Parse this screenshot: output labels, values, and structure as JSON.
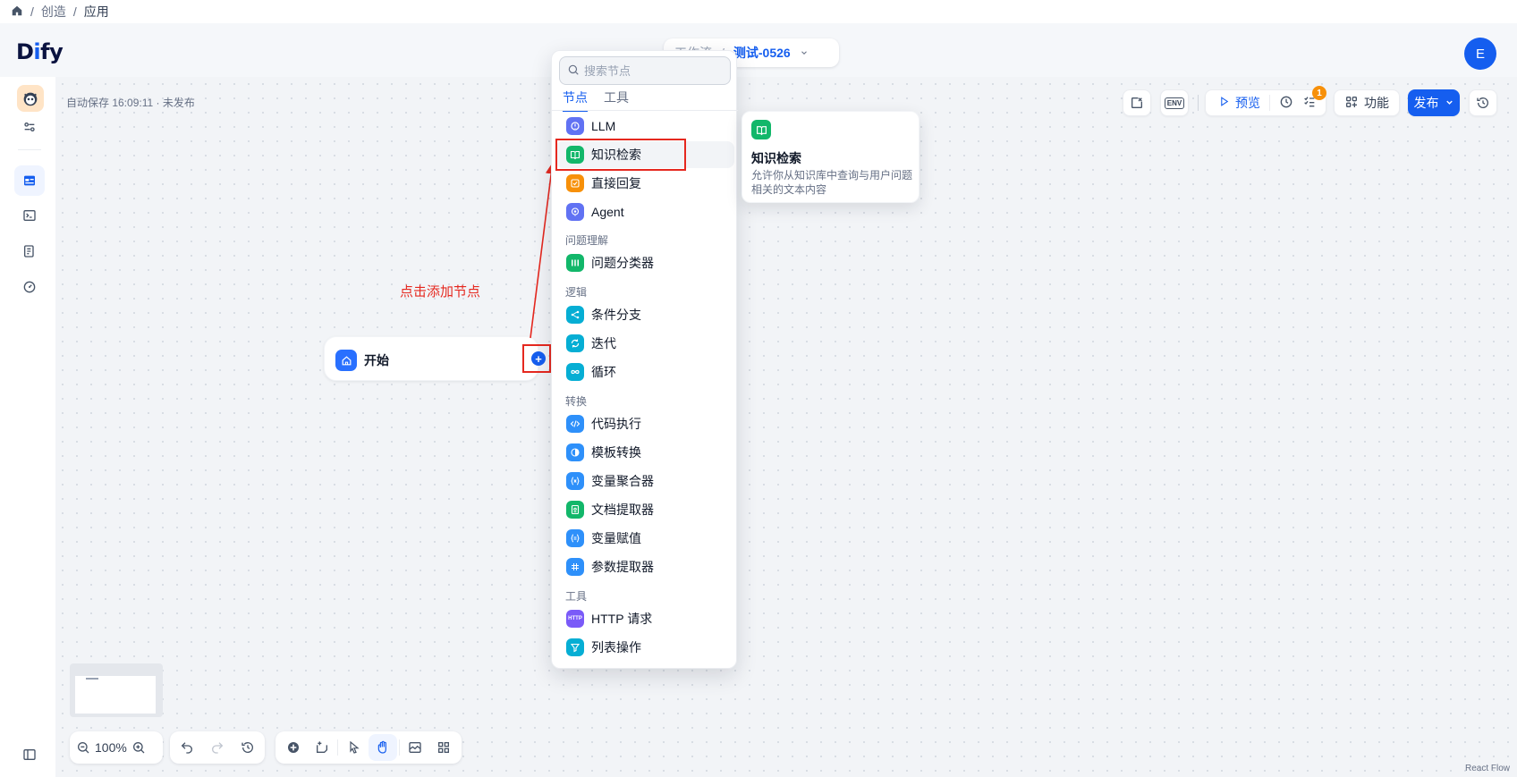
{
  "breadcrumb": {
    "home_icon": "home-icon",
    "sep": "/",
    "item1": "创造",
    "item2": "应用"
  },
  "header": {
    "logo_prefix": "D",
    "logo_i": "i",
    "logo_suffix": "fy",
    "tab_left": "工作流",
    "tab_right": "测试-0526",
    "avatar_letter": "E"
  },
  "canvas": {
    "autosave": "自动保存 16:09:11 · 未发布"
  },
  "toolbar": {
    "env_label": "ENV",
    "preview": "预览",
    "checklist_badge": "1",
    "features": "功能",
    "publish": "发布"
  },
  "start_node": {
    "label": "开始"
  },
  "annotation": {
    "text": "点击添加节点",
    "color": "#e5281f"
  },
  "node_menu": {
    "search_placeholder": "搜索节点",
    "tabs": [
      "节点",
      "工具"
    ],
    "items_top": [
      {
        "label": "LLM",
        "color": "#6172f3",
        "icon": "llm-icon"
      },
      {
        "label": "知识检索",
        "color": "#12b76a",
        "icon": "knowledge-retrieval-icon"
      },
      {
        "label": "直接回复",
        "color": "#f79009",
        "icon": "direct-reply-icon"
      },
      {
        "label": "Agent",
        "color": "#6172f3",
        "icon": "agent-icon"
      }
    ],
    "group_understanding": "问题理解",
    "items_understanding": [
      {
        "label": "问题分类器",
        "color": "#12b76a",
        "icon": "question-classifier-icon"
      }
    ],
    "group_logic": "逻辑",
    "items_logic": [
      {
        "label": "条件分支",
        "color": "#06aed4",
        "icon": "if-else-icon"
      },
      {
        "label": "迭代",
        "color": "#06aed4",
        "icon": "iteration-icon"
      },
      {
        "label": "循环",
        "color": "#06aed4",
        "icon": "loop-icon"
      }
    ],
    "group_transform": "转换",
    "items_transform": [
      {
        "label": "代码执行",
        "color": "#2e90fa",
        "icon": "code-icon"
      },
      {
        "label": "模板转换",
        "color": "#2e90fa",
        "icon": "template-icon"
      },
      {
        "label": "变量聚合器",
        "color": "#2e90fa",
        "icon": "variable-aggregator-icon"
      },
      {
        "label": "文档提取器",
        "color": "#12b76a",
        "icon": "doc-extractor-icon"
      },
      {
        "label": "变量赋值",
        "color": "#2e90fa",
        "icon": "variable-assigner-icon"
      },
      {
        "label": "参数提取器",
        "color": "#2e90fa",
        "icon": "parameter-extractor-icon"
      }
    ],
    "group_tools": "工具",
    "items_tools": [
      {
        "label": "HTTP 请求",
        "color": "#7a5af8",
        "icon": "http-icon",
        "icon_text": "HTTP"
      },
      {
        "label": "列表操作",
        "color": "#06aed4",
        "icon": "list-filter-icon"
      }
    ]
  },
  "tooltip": {
    "title": "知识检索",
    "description": "允许你从知识库中查询与用户问题相关的文本内容"
  },
  "bottom": {
    "zoom": "100%"
  },
  "footer": {
    "react_flow": "React Flow"
  }
}
